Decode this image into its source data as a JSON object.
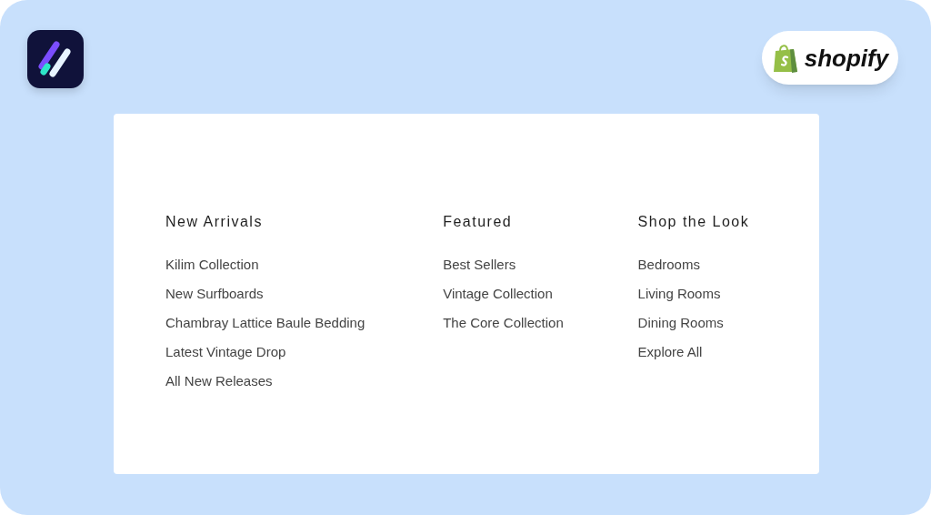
{
  "brand": {
    "name": "shopify"
  },
  "menu": {
    "columns": [
      {
        "heading": "New Arrivals",
        "links": [
          "Kilim Collection",
          "New Surfboards",
          "Chambray Lattice Baule Bedding",
          "Latest Vintage Drop",
          "All New Releases"
        ]
      },
      {
        "heading": "Featured",
        "links": [
          "Best Sellers",
          "Vintage Collection",
          "The Core Collection"
        ]
      },
      {
        "heading": "Shop the Look",
        "links": [
          "Bedrooms",
          "Living Rooms",
          "Dining Rooms",
          "Explore All"
        ]
      }
    ]
  }
}
